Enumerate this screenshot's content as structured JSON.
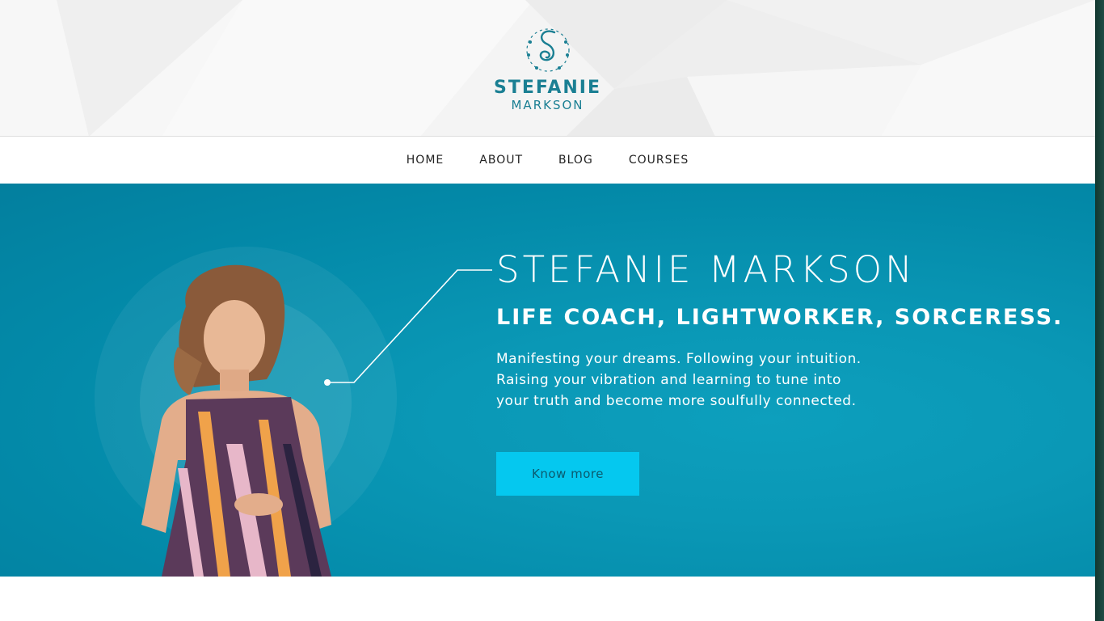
{
  "brand": {
    "name": "STEFANIE",
    "surname": "MARKSON",
    "emblem_icon": "spiral-s-wreath-icon",
    "color": "#1a7f93"
  },
  "nav": {
    "items": [
      {
        "label": "HOME"
      },
      {
        "label": "ABOUT"
      },
      {
        "label": "BLOG"
      },
      {
        "label": "COURSES"
      }
    ]
  },
  "hero": {
    "title": "STEFANIE MARKSON",
    "subtitle": "LIFE COACH, LIGHTWORKER, SORCERESS.",
    "description_lines": [
      "Manifesting your dreams. Following your intuition.",
      "Raising your vibration and learning to tune into",
      "your truth and become more soulfully connected."
    ],
    "cta_label": "Know more",
    "accent": "#0a98b6",
    "cta_color": "#05c8ef",
    "portrait": "woman-in-striped-dress-photo"
  }
}
